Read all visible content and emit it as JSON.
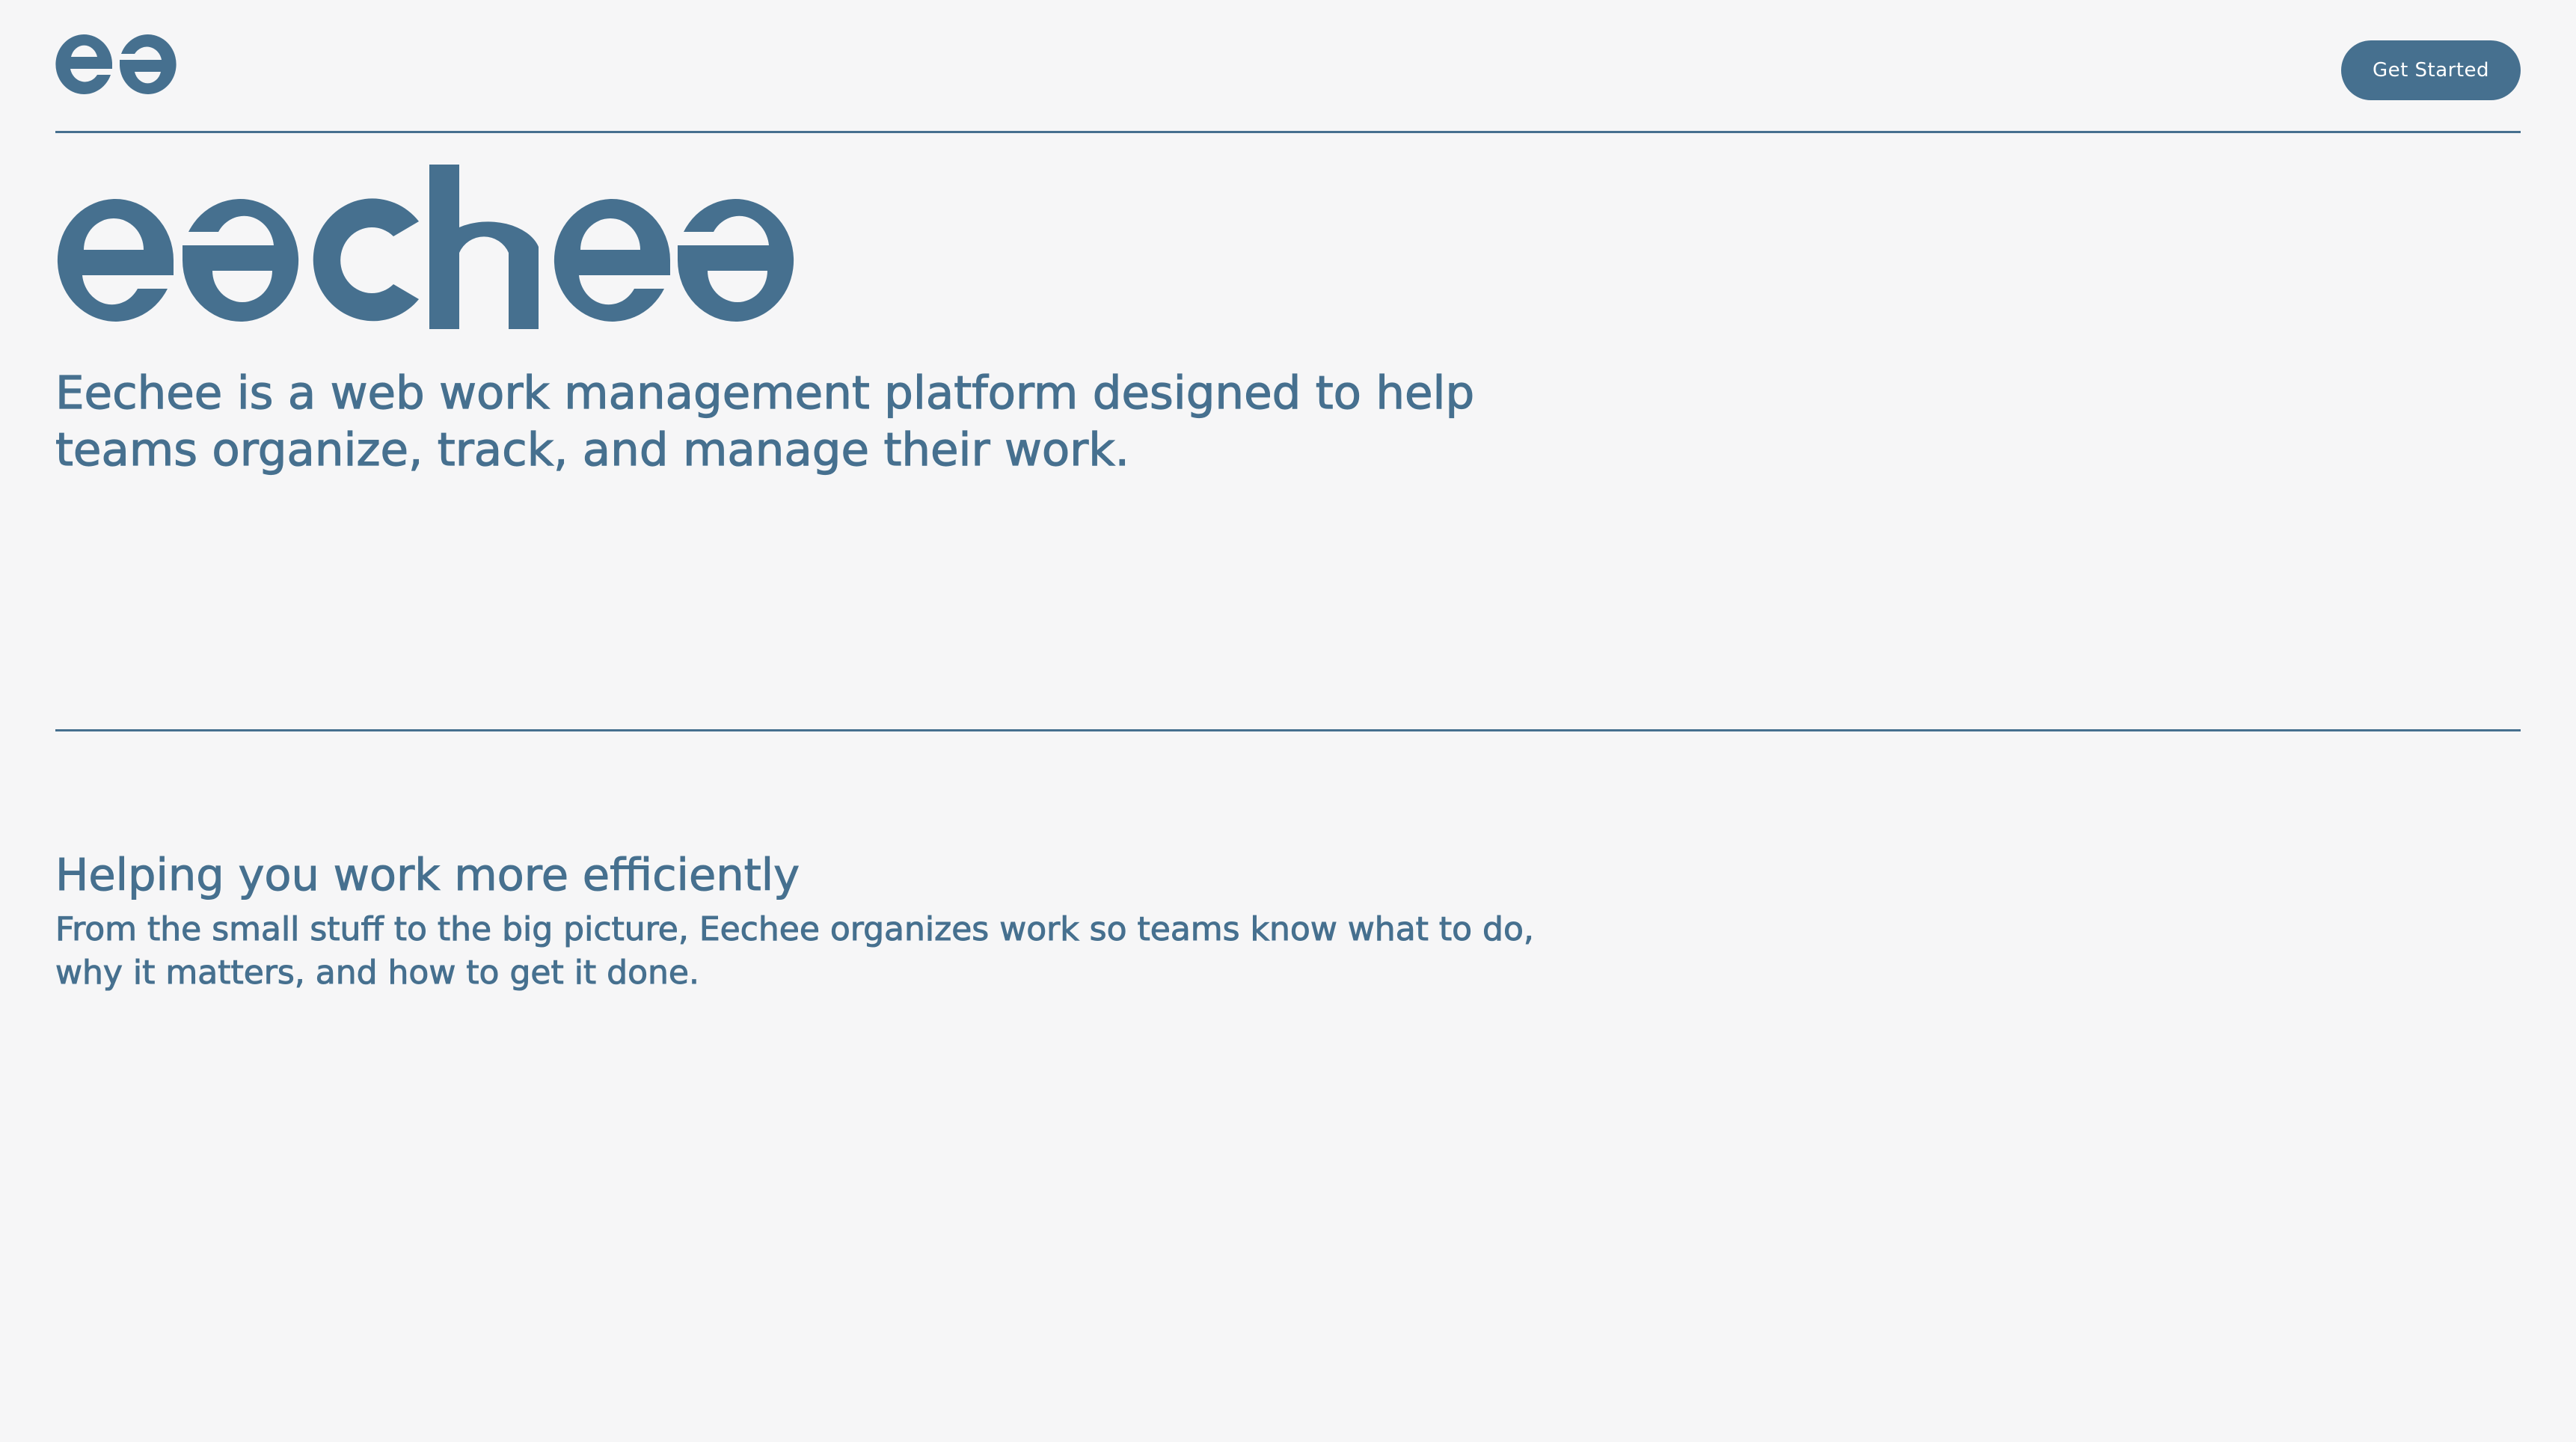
{
  "brand": {
    "logo_icon": "ee-logo-icon",
    "wordmark_icon": "eechee-wordmark-logo",
    "wordmark_text": "eechee",
    "accent_color": "#46708f",
    "background_color": "#f6f6f7"
  },
  "header": {
    "cta_label": "Get Started"
  },
  "hero": {
    "description": "Eechee is a web work management platform designed to help teams organize, track, and manage their work."
  },
  "section": {
    "title": "Helping you work more efficiently",
    "body": "From the small stuff to the big picture, Eechee organizes work so teams know what to do, why it matters, and how to get it done."
  }
}
